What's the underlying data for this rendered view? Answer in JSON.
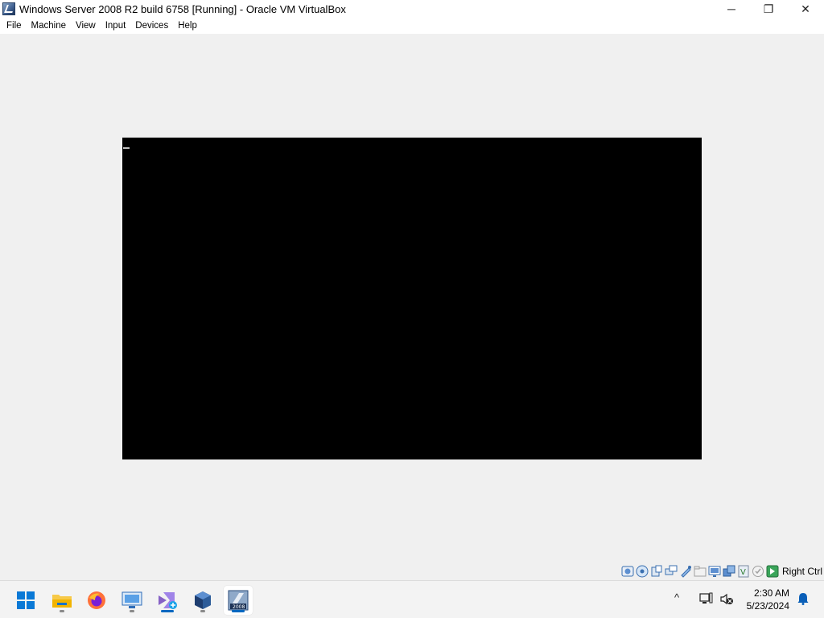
{
  "window": {
    "title": "Windows Server 2008 R2 build 6758 [Running] - Oracle VM VirtualBox",
    "minimize_glyph": "─",
    "maximize_glyph": "❐",
    "close_glyph": "✕"
  },
  "menu": [
    "File",
    "Machine",
    "View",
    "Input",
    "Devices",
    "Help"
  ],
  "vm": {
    "state": "Running",
    "screen_color": "#000000"
  },
  "statusbar": {
    "icons": [
      "hard-disk-icon",
      "optical-drive-icon",
      "audio-icon",
      "network-icon",
      "usb-icon",
      "shared-folders-icon",
      "display-icon",
      "video-capture-icon",
      "virtualization-icon",
      "mouse-integration-icon",
      "host-key-icon"
    ],
    "host_key": "Right Ctrl"
  },
  "taskbar": {
    "apps": [
      "start-icon",
      "file-explorer-icon",
      "firefox-icon",
      "remote-desktop-icon",
      "visual-studio-icon",
      "virtualbox-icon",
      "windows-server-2008-vm-icon"
    ],
    "active_app": "windows-server-2008-vm-icon",
    "tray_chevron": "^"
  },
  "clock": {
    "time": "2:30 AM",
    "date": "5/23/2024"
  },
  "colors": {
    "accent": "#0067c0",
    "titlebar": "#ffffff",
    "desktop": "#f0f0f0"
  }
}
